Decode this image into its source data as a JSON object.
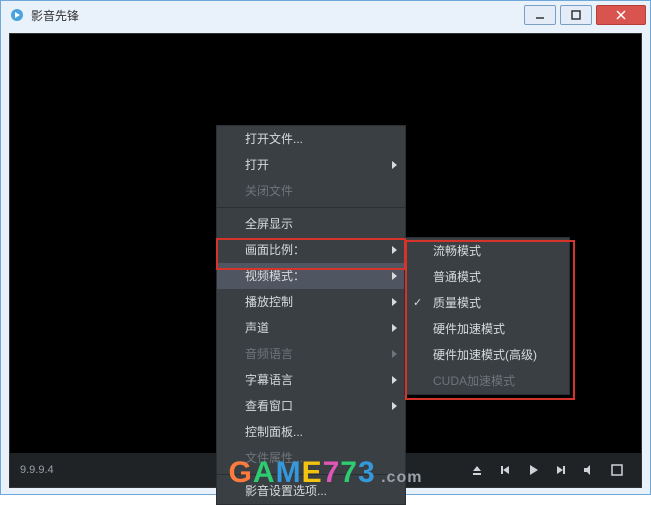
{
  "window": {
    "title": "影音先锋"
  },
  "logo": "ny",
  "controlbar": {
    "version": "9.9.9.4"
  },
  "menu": {
    "items": [
      {
        "label": "打开文件...",
        "sub": false,
        "dis": false
      },
      {
        "label": "打开",
        "sub": true,
        "dis": false
      },
      {
        "label": "关闭文件",
        "sub": false,
        "dis": true
      },
      {
        "sep": true
      },
      {
        "label": "全屏显示",
        "sub": false,
        "dis": false
      },
      {
        "label": "画面比例：",
        "sub": true,
        "dis": false
      },
      {
        "label": "视频模式：",
        "sub": true,
        "dis": false,
        "sel": true
      },
      {
        "label": "播放控制",
        "sub": true,
        "dis": false
      },
      {
        "label": "声道",
        "sub": true,
        "dis": false
      },
      {
        "label": "音频语言",
        "sub": true,
        "dis": true
      },
      {
        "label": "字幕语言",
        "sub": true,
        "dis": false
      },
      {
        "label": "查看窗口",
        "sub": true,
        "dis": false
      },
      {
        "label": "控制面板...",
        "sub": false,
        "dis": false
      },
      {
        "label": "文件属性...",
        "sub": false,
        "dis": true
      },
      {
        "sep": true
      },
      {
        "label": "影音设置选项...",
        "sub": false,
        "dis": false
      }
    ]
  },
  "submenu": {
    "items": [
      {
        "label": "流畅模式",
        "check": false,
        "dis": false
      },
      {
        "label": "普通模式",
        "check": false,
        "dis": false
      },
      {
        "label": "质量模式",
        "check": true,
        "dis": false
      },
      {
        "label": "硬件加速模式",
        "check": false,
        "dis": false
      },
      {
        "label": "硬件加速模式(高级)",
        "check": false,
        "dis": false
      },
      {
        "label": "CUDA加速模式",
        "check": false,
        "dis": true
      }
    ]
  },
  "watermark": {
    "text": "GAME773",
    "suffix": ".com"
  }
}
